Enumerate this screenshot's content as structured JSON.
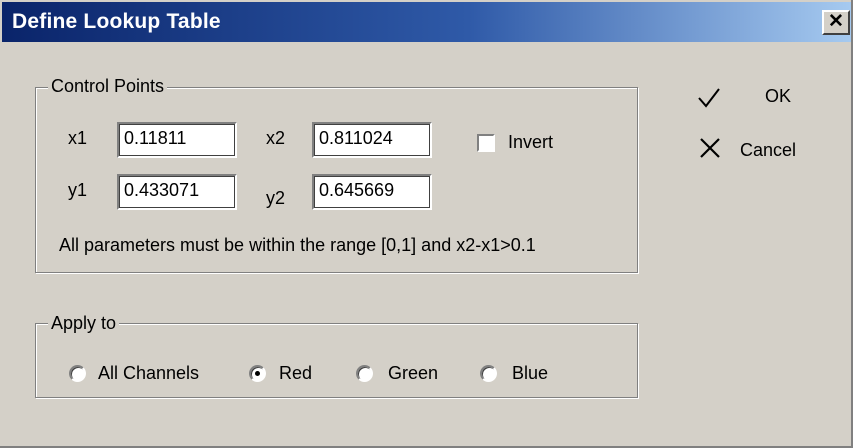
{
  "window": {
    "title": "Define Lookup Table",
    "close_glyph": "✕"
  },
  "control_points": {
    "legend": "Control Points",
    "x1_label": "x1",
    "x1_value": "0.11811",
    "x2_label": "x2",
    "x2_value": "0.811024",
    "y1_label": "y1",
    "y1_value": "0.433071",
    "y2_label": "y2",
    "y2_value": "0.645669",
    "invert_label": "Invert",
    "invert_checked": false,
    "note": "All parameters must be within the range [0,1] and x2-x1>0.1"
  },
  "apply_to": {
    "legend": "Apply to",
    "options": [
      {
        "label": "All Channels",
        "selected": false
      },
      {
        "label": "Red",
        "selected": true
      },
      {
        "label": "Green",
        "selected": false
      },
      {
        "label": "Blue",
        "selected": false
      }
    ]
  },
  "buttons": {
    "ok_label": "OK",
    "ok_icon": "checkmark-icon",
    "cancel_label": "Cancel",
    "cancel_icon": "x-mark-icon"
  },
  "colors": {
    "titlebar_start": "#0a246a",
    "titlebar_end": "#a6caf0",
    "dialog_bg": "#d4d0c8"
  }
}
